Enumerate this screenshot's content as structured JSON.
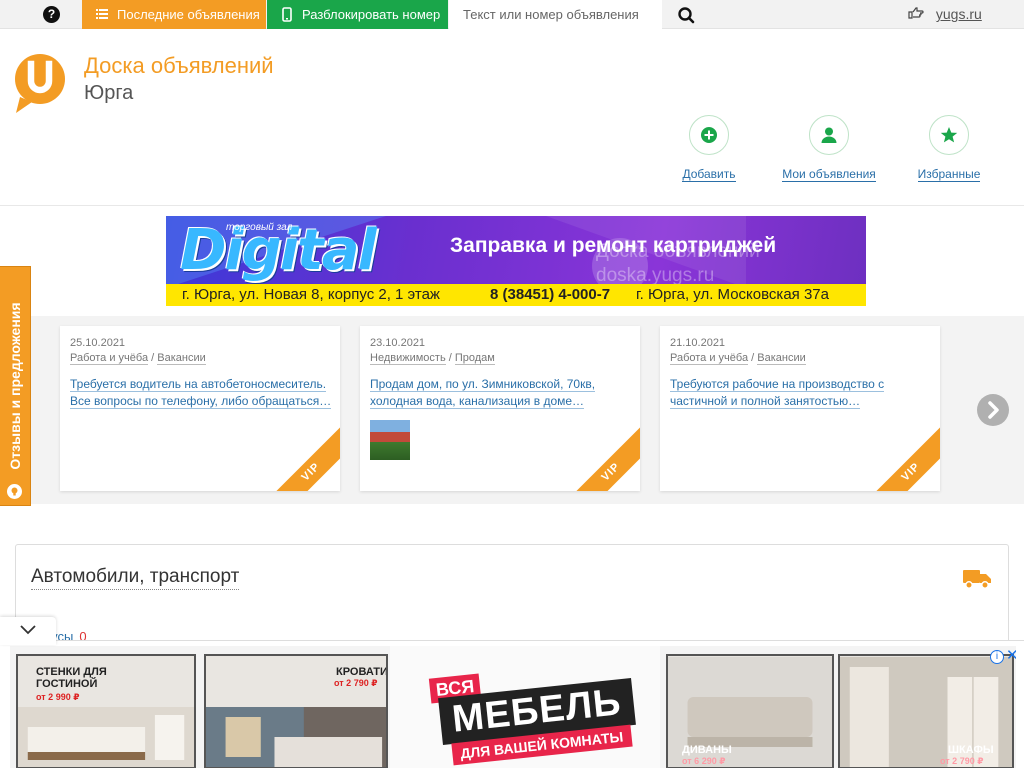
{
  "topbar": {
    "help_icon": "question-icon",
    "last_ads_label": "Последние объявления",
    "last_ads_icon": "list-icon",
    "unlock_label": "Разблокировать номер",
    "unlock_icon": "phone-icon",
    "search_placeholder": "Текст или номер объявления",
    "search_icon": "search-icon",
    "site_icon": "hand-point-icon",
    "site_domain": "yugs.ru"
  },
  "header": {
    "title": "Доска объявлений",
    "city": "Юрга",
    "actions": [
      {
        "label": "Добавить",
        "icon": "plus-circle-icon"
      },
      {
        "label": "Мои объявления",
        "icon": "user-icon"
      },
      {
        "label": "Избранные",
        "icon": "star-icon"
      }
    ]
  },
  "banner": {
    "brand_small": "торговый зал",
    "brand": "Digital",
    "slogan": "Заправка и ремонт картриджей",
    "watermark_line1": "Доска объявлений",
    "watermark_line2": "doska.yugs.ru",
    "address_left": "г. Юрга, ул. Новая 8, корпус 2, 1 этаж",
    "phone": "8 (38451) 4-000-7",
    "address_right": "г. Юрга, ул. Московская 37а"
  },
  "listings": [
    {
      "date": "25.10.2021",
      "category": "Работа и учёба",
      "subcategory": "Вакансии",
      "title": "Требуется водитель на автобетоносмеситель. Все вопросы по телефону, либо обращаться…",
      "badge": "VIP"
    },
    {
      "date": "23.10.2021",
      "category": "Недвижимость",
      "subcategory": "Продам",
      "title": "Продам дом, по ул. Зимниковской, 70кв, холодная вода, канализация в доме…",
      "badge": "VIP"
    },
    {
      "date": "21.10.2021",
      "category": "Работа и учёба",
      "subcategory": "Вакансии",
      "title": "Требуются рабочие на производство с частичной и полной занятостью…",
      "badge": "VIP"
    }
  ],
  "feedback": {
    "label": "Отзывы и предложения"
  },
  "category_box": {
    "title": "Автомобили, транспорт",
    "icon": "truck-icon",
    "sub_label": "…бусы",
    "sub_count": "0"
  },
  "ad": {
    "tile1_title": "СТЕНКИ ДЛЯ ГОСТИНОЙ",
    "tile1_price": "от 2 990 ₽",
    "tile2_title": "КРОВАТИ",
    "tile2_price": "от 2 790 ₽",
    "badge_all": "ВСЯ",
    "badge_main": "МЕБЕЛЬ",
    "badge_sub": "ДЛЯ ВАШЕЙ КОМНАТЫ",
    "tile3_title": "ДИВАНЫ",
    "tile3_price": "от 6 290 ₽",
    "tile4_title": "ШКАФЫ",
    "tile4_price": "от 2 790 ₽"
  },
  "colors": {
    "accent": "#f39c24",
    "green": "#1aa64a",
    "link": "#2a6fa8"
  }
}
